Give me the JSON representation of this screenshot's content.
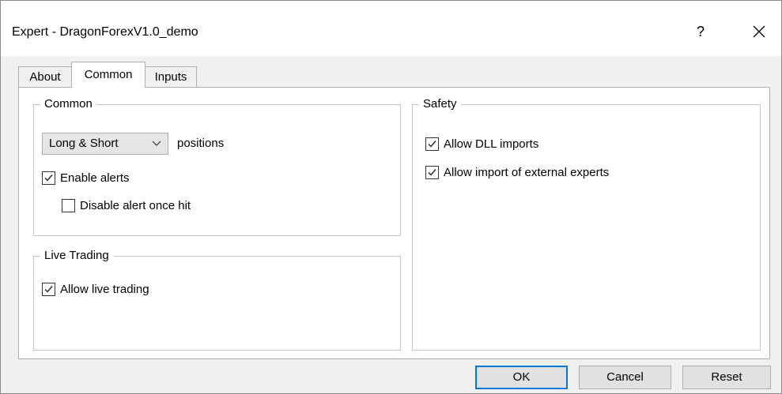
{
  "window": {
    "title": "Expert - DragonForexV1.0_demo",
    "help_label": "?"
  },
  "tabs": [
    {
      "label": "About"
    },
    {
      "label": "Common"
    },
    {
      "label": "Inputs"
    }
  ],
  "common_group": {
    "title": "Common",
    "positions_select": {
      "value": "Long & Short"
    },
    "positions_label": "positions",
    "enable_alerts": {
      "label": "Enable alerts",
      "checked": true
    },
    "disable_alert_once_hit": {
      "label": "Disable alert once hit",
      "checked": false
    }
  },
  "live_group": {
    "title": "Live Trading",
    "allow_live_trading": {
      "label": "Allow live trading",
      "checked": true
    }
  },
  "safety_group": {
    "title": "Safety",
    "allow_dll_imports": {
      "label": "Allow DLL imports",
      "checked": true
    },
    "allow_external_experts": {
      "label": "Allow import of external experts",
      "checked": true
    }
  },
  "buttons": {
    "ok": "OK",
    "cancel": "Cancel",
    "reset": "Reset"
  },
  "icons": {
    "close": "close-icon",
    "dropdown": "chevron-down-icon",
    "check": "checkmark-icon"
  },
  "colors": {
    "accent": "#0078d7",
    "titlebar": "#ffffff",
    "dialog_bg": "#f0f0f0"
  }
}
